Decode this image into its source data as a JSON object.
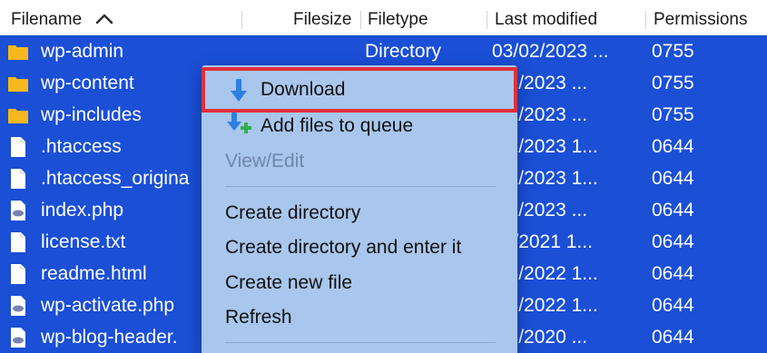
{
  "columns": {
    "filename": "Filename",
    "filesize": "Filesize",
    "filetype": "Filetype",
    "modified": "Last modified",
    "permissions": "Permissions"
  },
  "files": [
    {
      "name": "wp-admin",
      "type": "Directory",
      "date": "03/02/2023 ...",
      "perm": "0755",
      "icon": "folder-icon"
    },
    {
      "name": "wp-content",
      "type": "",
      "date": "/02/2023 ...",
      "perm": "0755",
      "icon": "folder-icon"
    },
    {
      "name": "wp-includes",
      "type": "",
      "date": "/02/2023 ...",
      "perm": "0755",
      "icon": "folder-icon"
    },
    {
      "name": ".htaccess",
      "type": "",
      "date": "/02/2023 1...",
      "perm": "0644",
      "icon": "file-icon"
    },
    {
      "name": ".htaccess_origina",
      "type": "",
      "date": "/01/2023 1...",
      "perm": "0644",
      "icon": "file-icon"
    },
    {
      "name": "index.php",
      "type": "",
      "date": "/02/2023 ...",
      "perm": "0644",
      "icon": "php-file-icon"
    },
    {
      "name": "license.txt",
      "type": "",
      "date": "31/2021 1...",
      "perm": "0644",
      "icon": "file-icon"
    },
    {
      "name": "readme.html",
      "type": "",
      "date": "/16/2022 1...",
      "perm": "0644",
      "icon": "file-icon"
    },
    {
      "name": "wp-activate.php",
      "type": "",
      "date": "/16/2022 1...",
      "perm": "0644",
      "icon": "php-file-icon"
    },
    {
      "name": "wp-blog-header.",
      "type": "",
      "date": "/05/2020 ...",
      "perm": "0644",
      "icon": "php-file-icon"
    }
  ],
  "menu": {
    "download": "Download",
    "add_queue": "Add files to queue",
    "view_edit": "View/Edit",
    "create_dir": "Create directory",
    "create_dir_enter": "Create directory and enter it",
    "create_file": "Create new file",
    "refresh": "Refresh"
  },
  "colors": {
    "selection": "#1a4fd6",
    "menu_bg": "#a9c6ec",
    "highlight_border": "#e0303a",
    "folder": "#f5b91e"
  }
}
